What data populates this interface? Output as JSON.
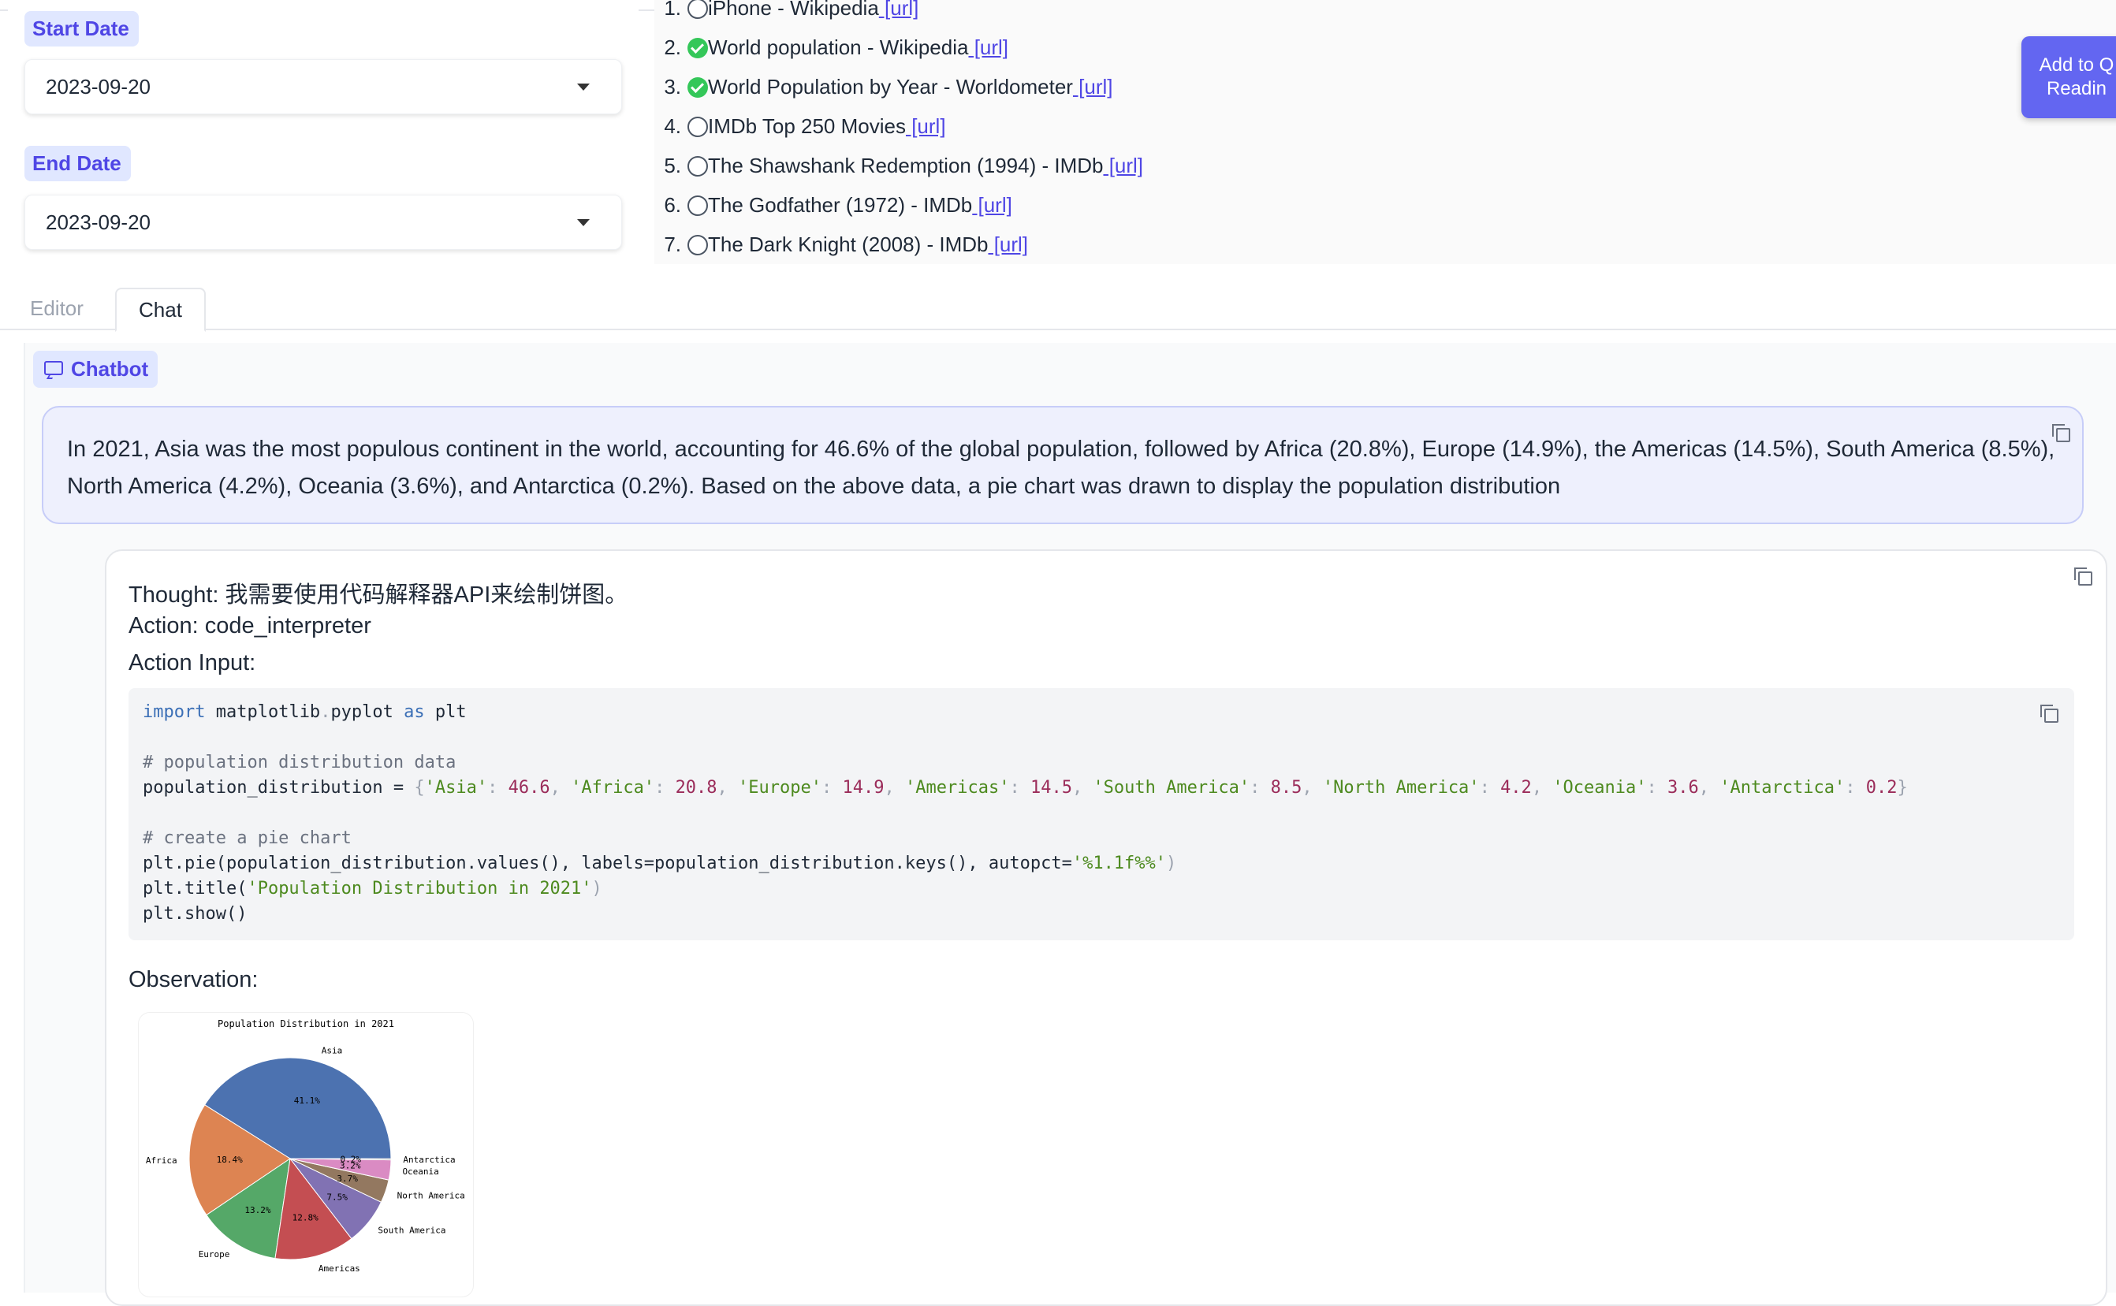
{
  "date_filters": {
    "start_label": "Start Date",
    "start_value": "2023-09-20",
    "end_label": "End Date",
    "end_value": "2023-09-20"
  },
  "results": [
    {
      "num": "1.",
      "title": "iPhone - Wikipedia",
      "link": "[url]",
      "checked": false
    },
    {
      "num": "2.",
      "title": "World population - Wikipedia",
      "link": "[url]",
      "checked": true
    },
    {
      "num": "3.",
      "title": "World Population by Year - Worldometer",
      "link": "[url]",
      "checked": true
    },
    {
      "num": "4.",
      "title": "IMDb Top 250 Movies",
      "link": "[url]",
      "checked": false
    },
    {
      "num": "5.",
      "title": "The Shawshank Redemption (1994) - IMDb",
      "link": "[url]",
      "checked": false
    },
    {
      "num": "6.",
      "title": "The Godfather (1972) - IMDb",
      "link": "[url]",
      "checked": false
    },
    {
      "num": "7.",
      "title": "The Dark Knight (2008) - IMDb",
      "link": "[url]",
      "checked": false
    }
  ],
  "add_button": {
    "line1": "Add to Q",
    "line2": "Readin"
  },
  "tabs": {
    "editor": "Editor",
    "chat": "Chat"
  },
  "chatbot_label": "Chatbot",
  "user_message": "In 2021, Asia was the most populous continent in the world, accounting for 46.6% of the global population, followed by Africa (20.8%), Europe (14.9%), the Americas (14.5%), South America (8.5%), North America (4.2%), Oceania (3.6%), and Antarctica (0.2%). Based on the above data, a pie chart was drawn to display the population distribution",
  "bot": {
    "thought": "Thought: 我需要使用代码解释器API来绘制饼图。",
    "action": "Action: code_interpreter",
    "action_input": "Action Input:",
    "observation": "Observation:"
  },
  "code": {
    "l1_kw1": "import",
    "l1_mod": " matplotlib",
    "l1_dot": ".",
    "l1_mod2": "pyplot ",
    "l1_kw2": "as",
    "l1_alias": " plt",
    "l2": "# population distribution data",
    "l3_start": "population_distribution = ",
    "l3_tokens": [
      [
        "'Asia'",
        "46.6"
      ],
      [
        "'Africa'",
        "20.8"
      ],
      [
        "'Europe'",
        "14.9"
      ],
      [
        "'Americas'",
        "14.5"
      ],
      [
        "'South America'",
        "8.5"
      ],
      [
        "'North America'",
        "4.2"
      ],
      [
        "'Oceania'",
        "3.6"
      ],
      [
        "'Antarctica'",
        "0.2"
      ]
    ],
    "l4": "# create a pie chart",
    "l5": "plt.pie(population_distribution.values(), labels=population_distribution.keys(), autopct=",
    "l5_str": "'%1.1f%%'",
    "l5_end": ")",
    "l6": "plt.title(",
    "l6_str": "'Population Distribution in 2021'",
    "l6_end": ")",
    "l7": "plt.show()"
  },
  "chart_data": {
    "type": "pie",
    "title": "Population Distribution in 2021",
    "categories": [
      "Asia",
      "Africa",
      "Europe",
      "Americas",
      "South America",
      "North America",
      "Oceania",
      "Antarctica"
    ],
    "values": [
      41.1,
      18.4,
      13.2,
      12.8,
      7.5,
      3.7,
      3.2,
      0.2
    ],
    "pct_labels": [
      "41.1%",
      "18.4%",
      "13.2%",
      "12.8%",
      "7.5%",
      "3.7%",
      "3.2%",
      "0.2%"
    ],
    "colors": [
      "#4c72b0",
      "#dd8452",
      "#55a868",
      "#c44e52",
      "#8172b3",
      "#937860",
      "#da8bc3",
      "#8c8c8c"
    ]
  }
}
